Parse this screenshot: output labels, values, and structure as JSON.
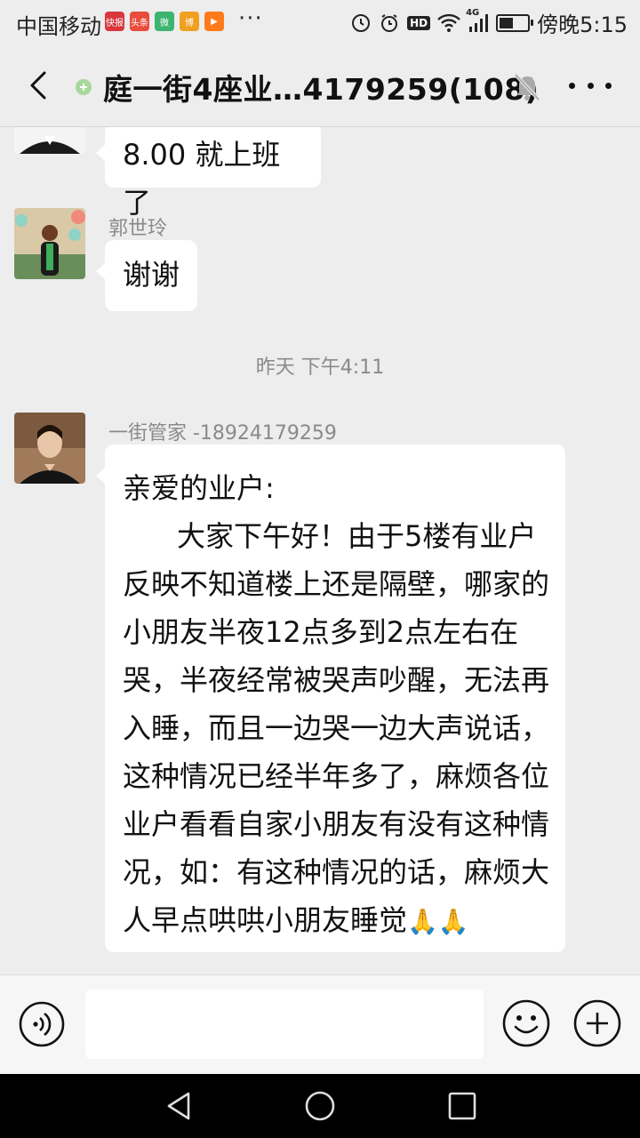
{
  "status_bar": {
    "carrier": "中国移动",
    "apps": [
      {
        "label": "快报",
        "color": "#d9363e"
      },
      {
        "label": "头条",
        "color": "#e94b3c"
      },
      {
        "label": "微",
        "color": "#3cb371"
      },
      {
        "label": "博",
        "color": "#f0a020"
      },
      {
        "label": "▶",
        "color": "#ff7a1a"
      }
    ],
    "more": "···",
    "network": "4G",
    "hd": "HD",
    "battery_level": 0.45,
    "time": "傍晚5:15"
  },
  "header": {
    "title": "庭一街4座业…4179259(108)"
  },
  "messages": [
    {
      "text": "8.00 就上班了"
    },
    {
      "sender": "郭世玲",
      "text": "谢谢"
    },
    {
      "timestamp": "昨天 下午4:11"
    },
    {
      "sender": "一街管家   -18924179259",
      "text": "亲爱的业户:\n      大家下午好！由于5楼有业户反映不知道楼上还是隔壁，哪家的小朋友半夜12点多到2点左右在哭，半夜经常被哭声吵醒，无法再入睡，而且一边哭一边大声说话，这种情况已经半年多了，麻烦各位业户看看自家小朋友有没有这种情况，如：有这种情况的话，麻烦大人早点哄哄小朋友睡觉",
      "emojis": "🙏🙏"
    }
  ],
  "input": {
    "placeholder": ""
  },
  "colors": {
    "background": "#ededed",
    "bubble": "#ffffff",
    "meta_text": "#8a8a8a"
  }
}
